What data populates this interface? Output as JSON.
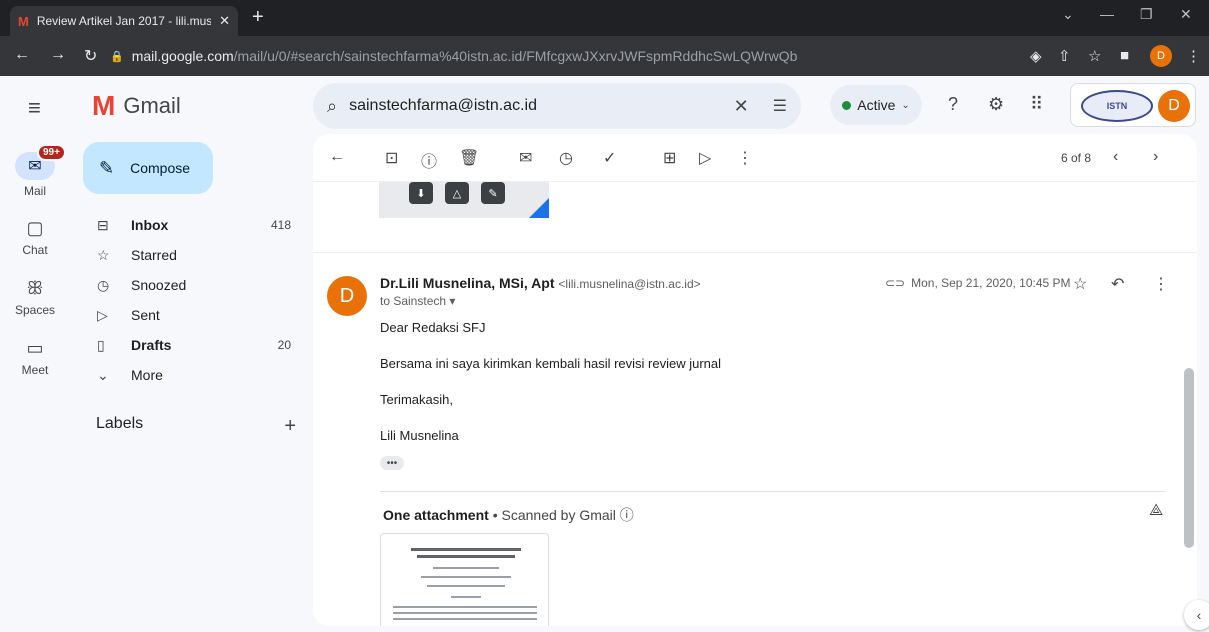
{
  "browser": {
    "tab_title": "Review Artikel Jan 2017 - lili.mus",
    "url_host": "mail.google.com",
    "url_rest": "/mail/u/0/#search/sainstechfarma%40istn.ac.id/FMfcgxwJXxrvJWFspmRddhcSwLQWrwQb",
    "profile_initial": "D"
  },
  "app": {
    "name": "Gmail",
    "search_value": "sainstechfarma@istn.ac.id",
    "status": "Active",
    "profile_initial": "D",
    "org_logo_text": "ISTN"
  },
  "rail": {
    "mail_badge": "99+",
    "items": [
      {
        "label": "Mail"
      },
      {
        "label": "Chat"
      },
      {
        "label": "Spaces"
      },
      {
        "label": "Meet"
      }
    ]
  },
  "nav": {
    "compose": "Compose",
    "items": [
      {
        "label": "Inbox",
        "count": "418"
      },
      {
        "label": "Starred",
        "count": ""
      },
      {
        "label": "Snoozed",
        "count": ""
      },
      {
        "label": "Sent",
        "count": ""
      },
      {
        "label": "Drafts",
        "count": "20"
      },
      {
        "label": "More",
        "count": ""
      }
    ],
    "labels_heading": "Labels"
  },
  "toolbar": {
    "pager": "6 of 8"
  },
  "message": {
    "sender_initial": "D",
    "sender_name": "Dr.Lili Musnelina, MSi, Apt",
    "sender_email": "<lili.musnelina@istn.ac.id>",
    "to": "to Sainstech",
    "date": "Mon, Sep 21, 2020, 10:45 PM",
    "body": [
      "Dear Redaksi SFJ",
      "Bersama ini saya kirimkan kembali hasil revisi review jurnal",
      "Terimakasih,",
      "Lili Musnelina"
    ],
    "more_dots": "•••"
  },
  "attachment": {
    "title": "One attachment",
    "scanned": "Scanned by Gmail"
  },
  "colors": {
    "accent": "#c2e7ff",
    "avatar": "#e8710a",
    "badge": "#b3261e",
    "active_dot": "#1e8e3e"
  }
}
